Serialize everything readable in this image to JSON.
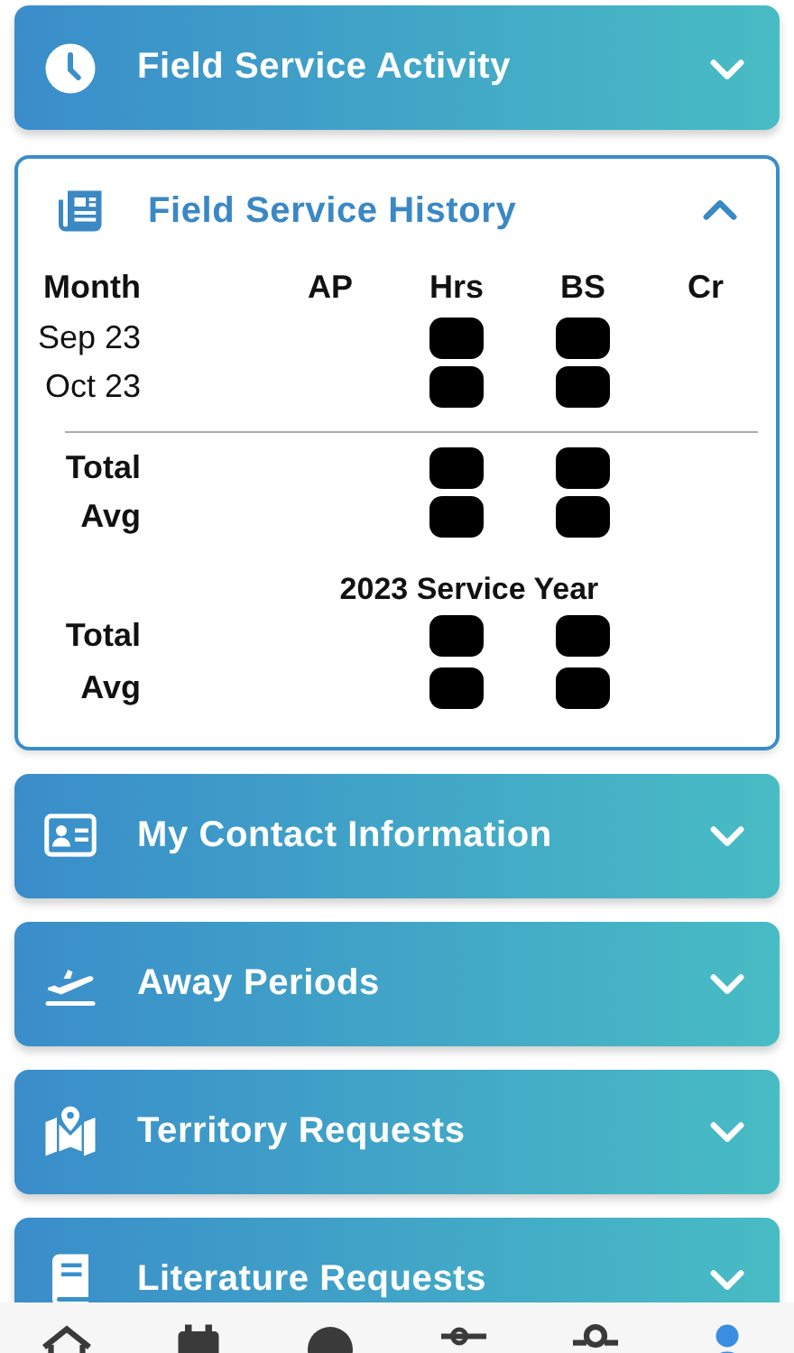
{
  "sections": [
    {
      "title": "Field Service Activity",
      "expanded": false
    },
    {
      "title": "Field Service History",
      "expanded": true
    },
    {
      "title": "My Contact Information",
      "expanded": false
    },
    {
      "title": "Away Periods",
      "expanded": false
    },
    {
      "title": "Territory Requests",
      "expanded": false
    },
    {
      "title": "Literature Requests",
      "expanded": false
    }
  ],
  "history": {
    "columns": [
      "Month",
      "AP",
      "Hrs",
      "BS",
      "Cr"
    ],
    "months": [
      {
        "label": "Sep 23",
        "redacted": [
          false,
          true,
          true,
          false
        ]
      },
      {
        "label": "Oct 23",
        "redacted": [
          false,
          true,
          true,
          false
        ]
      }
    ],
    "summary": [
      {
        "label": "Total",
        "redacted": [
          false,
          true,
          true,
          false
        ]
      },
      {
        "label": "Avg",
        "redacted": [
          false,
          true,
          true,
          false
        ]
      }
    ],
    "year_title": "2023 Service Year",
    "year": [
      {
        "label": "Total",
        "redacted": [
          false,
          true,
          true,
          false
        ]
      },
      {
        "label": "Avg",
        "redacted": [
          false,
          true,
          true,
          false
        ]
      }
    ]
  },
  "nav": [
    {
      "selected": false
    },
    {
      "selected": false
    },
    {
      "selected": false
    },
    {
      "selected": false
    },
    {
      "selected": false
    },
    {
      "selected": true
    }
  ]
}
